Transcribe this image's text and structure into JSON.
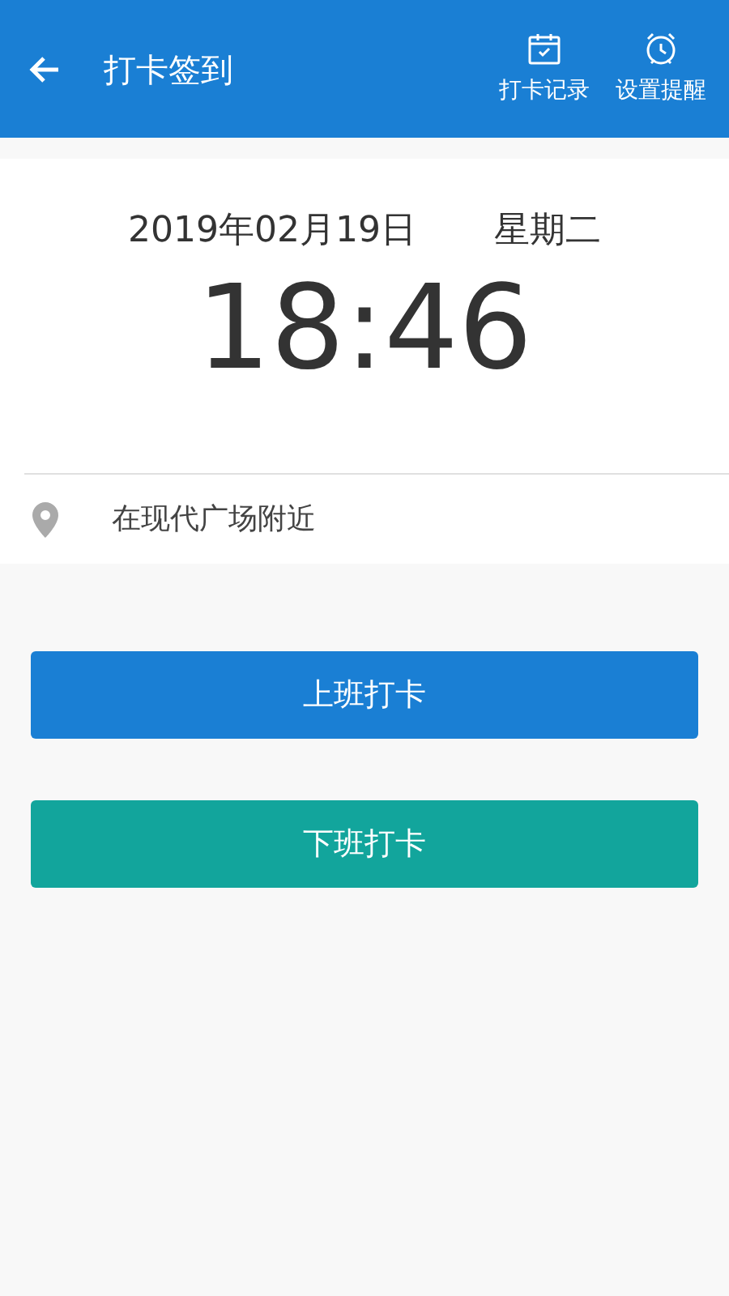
{
  "header": {
    "title": "打卡签到",
    "actions": [
      {
        "kind": "calendar",
        "label": "打卡记录"
      },
      {
        "kind": "alarm",
        "label": "设置提醒"
      }
    ]
  },
  "clock": {
    "date": "2019年02月19日",
    "weekday": "星期二",
    "time": "18:46"
  },
  "location": {
    "text": "在现代广场附近"
  },
  "buttons": [
    {
      "label": "上班打卡",
      "color": "#1a7fd4"
    },
    {
      "label": "下班打卡",
      "color": "#12a59c"
    }
  ]
}
